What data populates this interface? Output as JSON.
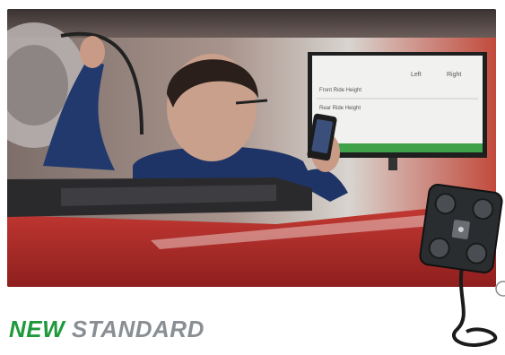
{
  "headline": {
    "word_1": "NEW",
    "word_2": "STANDARD",
    "color_word_1": "#1e9a3c",
    "color_word_2": "#8a8f94"
  },
  "monitor": {
    "col_left": "Left",
    "col_right": "Right",
    "row_1": "Front Ride Height",
    "row_2": "Rear Ride Height"
  },
  "colors": {
    "car_red": "#b8322e",
    "shirt_navy": "#1f3466",
    "device_body": "#2a2d30"
  }
}
